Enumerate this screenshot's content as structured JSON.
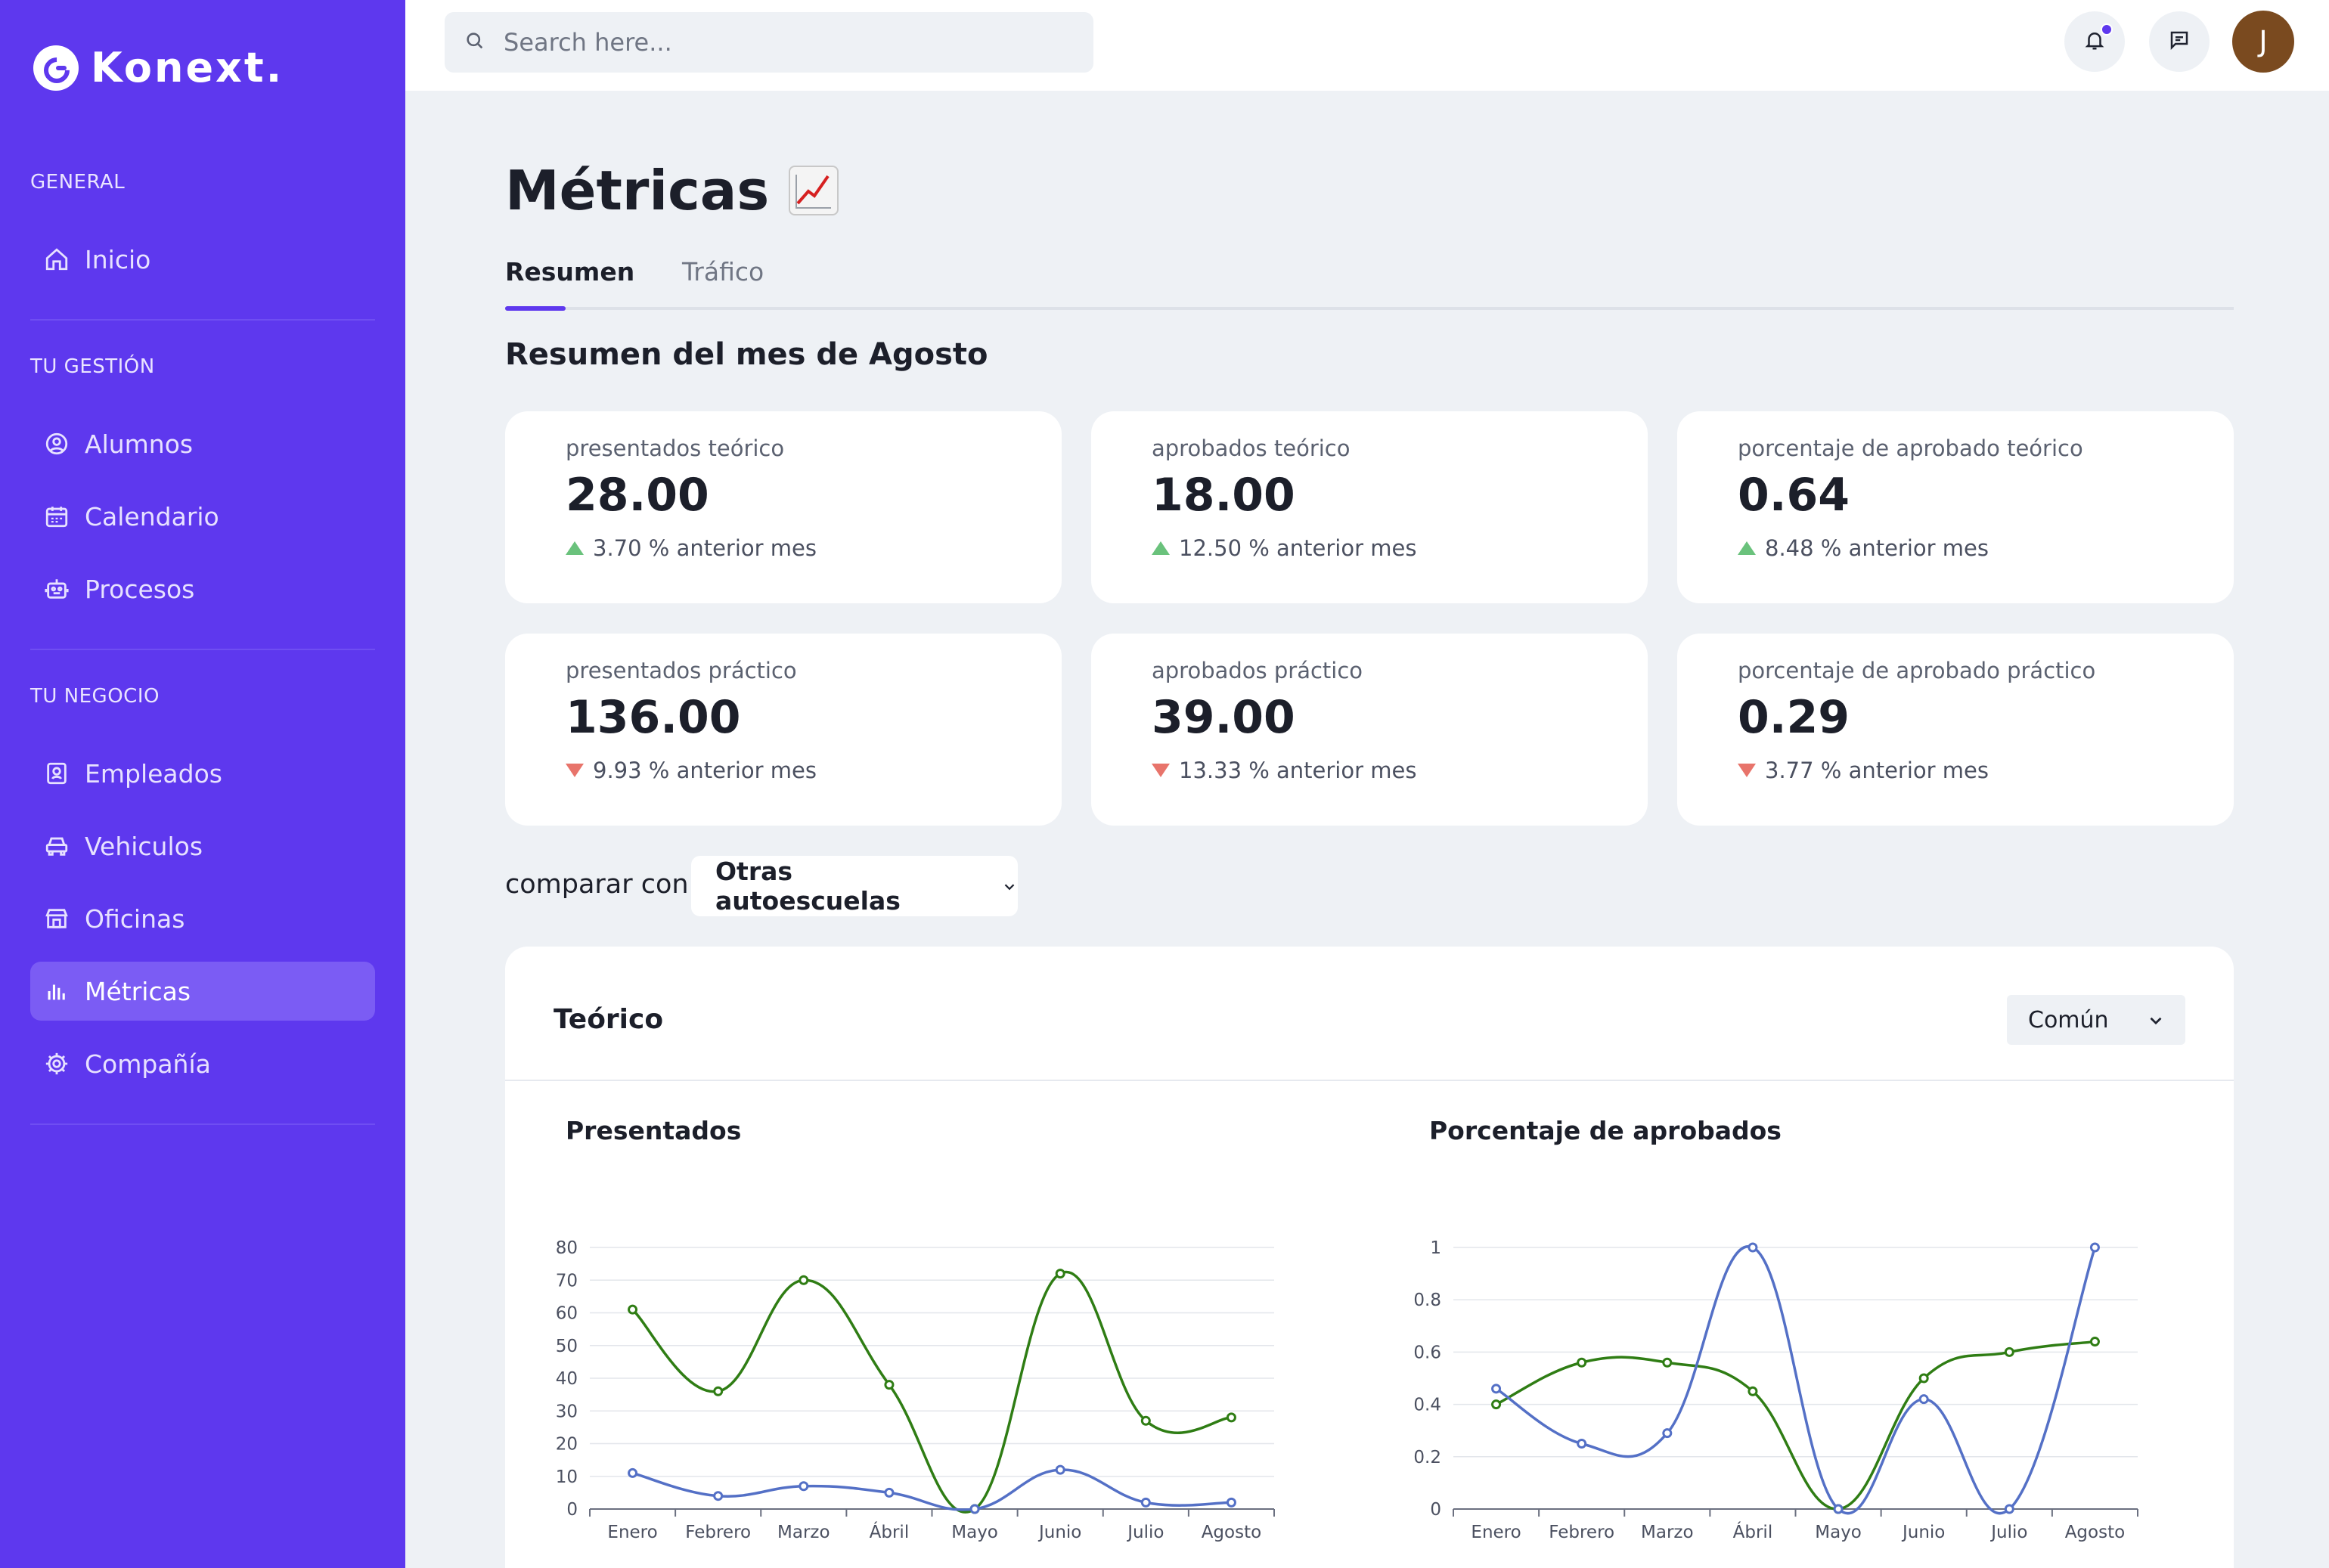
{
  "app": {
    "name": "Konext."
  },
  "sidebar": {
    "sections": [
      {
        "label": "GENERAL",
        "items": [
          {
            "label": "Inicio",
            "icon": "home-icon"
          }
        ]
      },
      {
        "label": "TU GESTIÓN",
        "items": [
          {
            "label": "Alumnos",
            "icon": "user-circle-icon"
          },
          {
            "label": "Calendario",
            "icon": "calendar-icon"
          },
          {
            "label": "Procesos",
            "icon": "robot-icon"
          }
        ]
      },
      {
        "label": "TU NEGOCIO",
        "items": [
          {
            "label": "Empleados",
            "icon": "id-badge-icon"
          },
          {
            "label": "Vehiculos",
            "icon": "car-icon"
          },
          {
            "label": "Oficinas",
            "icon": "store-icon"
          },
          {
            "label": "Métricas",
            "icon": "bar-chart-icon",
            "active": true
          },
          {
            "label": "Compañía",
            "icon": "gear-icon"
          }
        ]
      }
    ]
  },
  "topbar": {
    "search_placeholder": "Search here...",
    "avatar_initial": "J"
  },
  "page": {
    "title": "Métricas",
    "tabs": [
      {
        "label": "Resumen",
        "active": true
      },
      {
        "label": "Tráfico",
        "active": false
      }
    ],
    "subtitle": "Resumen del mes de Agosto"
  },
  "cards": [
    {
      "label": "presentados teórico",
      "value": "28.00",
      "change": "3.70 % anterior mes",
      "trend": "up"
    },
    {
      "label": "aprobados teórico",
      "value": "18.00",
      "change": "12.50 % anterior mes",
      "trend": "up"
    },
    {
      "label": "porcentaje de aprobado teórico",
      "value": "0.64",
      "change": "8.48 % anterior mes",
      "trend": "up"
    },
    {
      "label": "presentados práctico",
      "value": "136.00",
      "change": "9.93 % anterior mes",
      "trend": "down"
    },
    {
      "label": "aprobados práctico",
      "value": "39.00",
      "change": "13.33 % anterior mes",
      "trend": "down"
    },
    {
      "label": "porcentaje de aprobado práctico",
      "value": "0.29",
      "change": "3.77 % anterior mes",
      "trend": "down"
    }
  ],
  "compare": {
    "label": "comparar con",
    "selected": "Otras autoescuelas"
  },
  "panel": {
    "title": "Teórico",
    "selected": "Común"
  },
  "colors": {
    "primary": "#5e38ee",
    "series_green": "#2f7d14",
    "series_blue": "#5470c6",
    "up": "#6ac27c",
    "down": "#e8746b"
  },
  "chart_data": [
    {
      "type": "line",
      "title": "Presentados",
      "categories": [
        "Enero",
        "Febrero",
        "Marzo",
        "Ábril",
        "Mayo",
        "Junio",
        "Julio",
        "Agosto"
      ],
      "yticks": [
        "0",
        "10",
        "20",
        "30",
        "40",
        "50",
        "60",
        "70",
        "80"
      ],
      "ylim": [
        0,
        80
      ],
      "grid": true,
      "series": [
        {
          "color": "#2f7d14",
          "values": [
            61,
            36,
            70,
            38,
            0,
            72,
            27,
            28
          ]
        },
        {
          "color": "#5470c6",
          "values": [
            11,
            4,
            7,
            5,
            0,
            12,
            2,
            2
          ]
        }
      ]
    },
    {
      "type": "line",
      "title": "Porcentaje de aprobados",
      "categories": [
        "Enero",
        "Febrero",
        "Marzo",
        "Ábril",
        "Mayo",
        "Junio",
        "Julio",
        "Agosto"
      ],
      "yticks": [
        "0",
        "0.2",
        "0.4",
        "0.6",
        "0.8",
        "1"
      ],
      "ylim": [
        0,
        1
      ],
      "grid": true,
      "series": [
        {
          "color": "#2f7d14",
          "values": [
            0.4,
            0.56,
            0.56,
            0.45,
            0,
            0.5,
            0.6,
            0.64
          ]
        },
        {
          "color": "#5470c6",
          "values": [
            0.46,
            0.25,
            0.29,
            1,
            0,
            0.42,
            0,
            1
          ]
        }
      ]
    }
  ]
}
